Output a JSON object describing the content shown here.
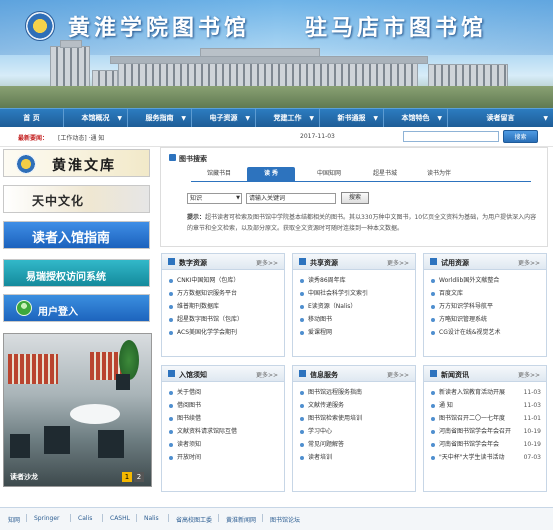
{
  "banner": {
    "title_left": "黄淮学院图书馆",
    "title_right": "驻马店市图书馆"
  },
  "nav": {
    "items": [
      {
        "label": "首 页",
        "has_dropdown": false
      },
      {
        "label": "本馆概况",
        "has_dropdown": true
      },
      {
        "label": "服务指南",
        "has_dropdown": true
      },
      {
        "label": "电子资源",
        "has_dropdown": true
      },
      {
        "label": "党建工作",
        "has_dropdown": true
      },
      {
        "label": "新书通报",
        "has_dropdown": true
      },
      {
        "label": "本馆特色",
        "has_dropdown": true
      },
      {
        "label": "读者留言",
        "has_dropdown": true
      }
    ]
  },
  "notice": {
    "label": "最新要闻：",
    "text": "[工作动态] ·通 知",
    "date": "2017-11-03",
    "search_button": "搜索"
  },
  "left": {
    "banners": [
      "黄淮文库",
      "天中文化",
      "读者入馆指南",
      "易瑞授权访问系统",
      "用户登入"
    ],
    "photo_caption": "读者沙龙",
    "pager": [
      "1",
      "2"
    ]
  },
  "book_search": {
    "title": "图书搜索",
    "tabs": [
      "馆藏书目",
      "读 秀",
      "中国知网",
      "超星书城",
      "读书为伴"
    ],
    "active_tab": 1,
    "select_value": "知识",
    "keyword_placeholder": "请输入关键词",
    "go_button": "搜索",
    "tip_label": "提示：",
    "tip_text": "超书读者可检索及图书馆中学院基本结都相关的图书。其以330万种中文图书，10亿页全文资料为基础，为用户提供深入内容的章节和全文检索，以及部分原文。获取全文资源时可随时连接到一种本文数据。"
  },
  "panels": [
    {
      "title": "数字资源",
      "more": "更多>>",
      "items": [
        "CNKI中国知网（包库）",
        "万方数据知识服务平台",
        "维普期刊数据库",
        "超星数字图书馆（包库）",
        "ACS美国化学学会期刊"
      ]
    },
    {
      "title": "共享资源",
      "more": "更多>>",
      "items": [
        "读秀86周年库",
        "中国社会科学引文索引",
        "E读资源（Nalis）",
        "移动图书",
        "爱课程网"
      ]
    },
    {
      "title": "试用资源",
      "more": "更多>>",
      "items": [
        "Worldlib国外文献整合",
        "百度文库",
        "万方知识学科导航平",
        "方略知识管理系统",
        "CG设计在线&视觉艺术"
      ]
    },
    {
      "title": "入馆须知",
      "more": "更多>>",
      "items": [
        "关于借阅",
        "借阅图书",
        "图书续借",
        "文献资料请求馆际互借",
        "读者须知",
        "开放时间"
      ]
    },
    {
      "title": "信息服务",
      "more": "更多>>",
      "items": [
        "图书馆远程服务指南",
        "文献传递服务",
        "图书馆检索使用培训",
        "学习中心",
        "常见问题解答",
        "读者培训"
      ]
    },
    {
      "title": "新闻资讯",
      "more": "更多>>",
      "items": [
        {
          "text": "新读者入馆教育活动开展",
          "date": "11-03"
        },
        {
          "text": "通 知",
          "date": "11-03"
        },
        {
          "text": "图书馆召开二〇一七年度",
          "date": "11-01"
        },
        {
          "text": "河南省图书馆学会年会召开",
          "date": "10-19"
        },
        {
          "text": "河南省图书馆学会年会",
          "date": "10-19"
        },
        {
          "text": "\"天中杯\"大学生读书活动",
          "date": "07-03"
        }
      ]
    }
  ],
  "footer": {
    "links": [
      "知网",
      "Springer",
      "Calis",
      "CASHL",
      "Nalis",
      "省高校图工委",
      "黄淮新闻网",
      "图书馆论坛"
    ]
  }
}
